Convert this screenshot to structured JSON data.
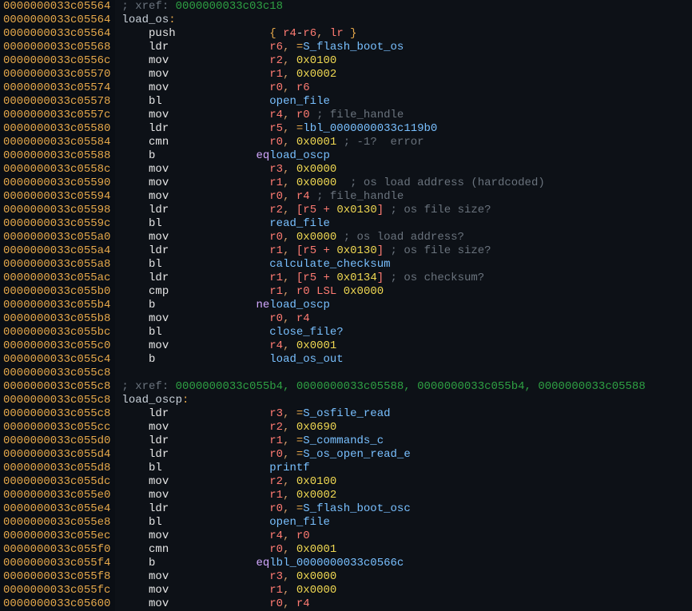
{
  "gutter_addrs": [
    "0000000033c05564",
    "0000000033c05564",
    "0000000033c05564",
    "0000000033c05568",
    "0000000033c0556c",
    "0000000033c05570",
    "0000000033c05574",
    "0000000033c05578",
    "0000000033c0557c",
    "0000000033c05580",
    "0000000033c05584",
    "0000000033c05588",
    "0000000033c0558c",
    "0000000033c05590",
    "0000000033c05594",
    "0000000033c05598",
    "0000000033c0559c",
    "0000000033c055a0",
    "0000000033c055a4",
    "0000000033c055a8",
    "0000000033c055ac",
    "0000000033c055b0",
    "0000000033c055b4",
    "0000000033c055b8",
    "0000000033c055bc",
    "0000000033c055c0",
    "0000000033c055c4",
    "0000000033c055c8",
    "0000000033c055c8",
    "0000000033c055c8",
    "0000000033c055c8",
    "0000000033c055cc",
    "0000000033c055d0",
    "0000000033c055d4",
    "0000000033c055d8",
    "0000000033c055dc",
    "0000000033c055e0",
    "0000000033c055e4",
    "0000000033c055e8",
    "0000000033c055ec",
    "0000000033c055f0",
    "0000000033c055f4",
    "0000000033c055f8",
    "0000000033c055fc",
    "0000000033c05600"
  ],
  "l": {
    "0": {
      "cmt": "; xref: ",
      "xref": "0000000033c03c18"
    },
    "1": {
      "lbl": "load_os",
      "colon": ":"
    },
    "2": {
      "mn": "push",
      "bopen": "{ ",
      "r1": "r4",
      "dash": "-",
      "r2": "r6",
      "c1": ", ",
      "r3": "lr",
      "bclose": " }"
    },
    "3": {
      "mn": "ldr",
      "r1": "r6",
      "c1": ", ",
      "eq": "=",
      "sym": "S_flash_boot_os"
    },
    "4": {
      "mn": "mov",
      "r1": "r2",
      "c1": ", ",
      "im": "0x0100"
    },
    "5": {
      "mn": "mov",
      "r1": "r1",
      "c1": ", ",
      "im": "0x0002"
    },
    "6": {
      "mn": "mov",
      "r1": "r0",
      "c1": ", ",
      "r2": "r6"
    },
    "7": {
      "mn": "bl",
      "sym": "open_file"
    },
    "8": {
      "mn": "mov",
      "r1": "r4",
      "c1": ", ",
      "r2": "r0",
      "cmt": " ; file_handle"
    },
    "9": {
      "mn": "ldr",
      "r1": "r5",
      "c1": ", ",
      "eq": "=",
      "sym": "lbl_0000000033c119b0"
    },
    "10": {
      "mn": "cmn",
      "r1": "r0",
      "c1": ", ",
      "im": "0x0001",
      "cmt": " ; -1?  error"
    },
    "11": {
      "mn": "b",
      "cd": "eq",
      "sym": "load_oscp"
    },
    "12": {
      "mn": "mov",
      "r1": "r3",
      "c1": ", ",
      "im": "0x0000"
    },
    "13": {
      "mn": "mov",
      "r1": "r1",
      "c1": ", ",
      "im": "0x0000",
      "cmt": "  ; os load address (hardcoded)"
    },
    "14": {
      "mn": "mov",
      "r1": "r0",
      "c1": ", ",
      "r2": "r4",
      "cmt": " ; file_handle"
    },
    "15": {
      "mn": "ldr",
      "r1": "r2",
      "c1": ", ",
      "bo": "[",
      "r2": "r5",
      "plus": " + ",
      "im": "0x0130",
      "bc": "]",
      "cmt": " ; os file size?"
    },
    "16": {
      "mn": "bl",
      "sym": "read_file"
    },
    "17": {
      "mn": "mov",
      "r1": "r0",
      "c1": ", ",
      "im": "0x0000",
      "cmt": " ; os load address?"
    },
    "18": {
      "mn": "ldr",
      "r1": "r1",
      "c1": ", ",
      "bo": "[",
      "r2": "r5",
      "plus": " + ",
      "im": "0x0130",
      "bc": "]",
      "cmt": " ; os file size?"
    },
    "19": {
      "mn": "bl",
      "sym": "calculate_checksum"
    },
    "20": {
      "mn": "ldr",
      "r1": "r1",
      "c1": ", ",
      "bo": "[",
      "r2": "r5",
      "plus": " + ",
      "im": "0x0134",
      "bc": "]",
      "cmt": " ; os checksum?"
    },
    "21": {
      "mn": "cmp",
      "r1": "r1",
      "c1": ", ",
      "r2": "r0",
      "spc": " ",
      "lsl": "LSL",
      "spc2": " ",
      "im": "0x0000"
    },
    "22": {
      "mn": "b",
      "cd": "ne",
      "sym": "load_oscp"
    },
    "23": {
      "mn": "mov",
      "r1": "r0",
      "c1": ", ",
      "r2": "r4"
    },
    "24": {
      "mn": "bl",
      "sym": "close_file?"
    },
    "25": {
      "mn": "mov",
      "r1": "r4",
      "c1": ", ",
      "im": "0x0001"
    },
    "26": {
      "mn": "b",
      "sym": "load_os_out"
    },
    "27": {
      "blank": " "
    },
    "28": {
      "cmt": "; xref: ",
      "xref": "0000000033c055b4, 0000000033c05588, 0000000033c055b4, 0000000033c05588"
    },
    "29": {
      "lbl": "load_oscp",
      "colon": ":"
    },
    "30": {
      "mn": "ldr",
      "r1": "r3",
      "c1": ", ",
      "eq": "=",
      "sym": "S_osfile_read"
    },
    "31": {
      "mn": "mov",
      "r1": "r2",
      "c1": ", ",
      "im": "0x0690"
    },
    "32": {
      "mn": "ldr",
      "r1": "r1",
      "c1": ", ",
      "eq": "=",
      "sym": "S_commands_c"
    },
    "33": {
      "mn": "ldr",
      "r1": "r0",
      "c1": ", ",
      "eq": "=",
      "sym": "S_os_open_read_e"
    },
    "34": {
      "mn": "bl",
      "sym": "printf"
    },
    "35": {
      "mn": "mov",
      "r1": "r2",
      "c1": ", ",
      "im": "0x0100"
    },
    "36": {
      "mn": "mov",
      "r1": "r1",
      "c1": ", ",
      "im": "0x0002"
    },
    "37": {
      "mn": "ldr",
      "r1": "r0",
      "c1": ", ",
      "eq": "=",
      "sym": "S_flash_boot_osc"
    },
    "38": {
      "mn": "bl",
      "sym": "open_file"
    },
    "39": {
      "mn": "mov",
      "r1": "r4",
      "c1": ", ",
      "r2": "r0"
    },
    "40": {
      "mn": "cmn",
      "r1": "r0",
      "c1": ", ",
      "im": "0x0001"
    },
    "41": {
      "mn": "b",
      "cd": "eq",
      "sym": "lbl_0000000033c0566c"
    },
    "42": {
      "mn": "mov",
      "r1": "r3",
      "c1": ", ",
      "im": "0x0000"
    },
    "43": {
      "mn": "mov",
      "r1": "r1",
      "c1": ", ",
      "im": "0x0000"
    },
    "44": {
      "mn": "mov",
      "r1": "r0",
      "c1": ", ",
      "r2": "r4"
    }
  }
}
